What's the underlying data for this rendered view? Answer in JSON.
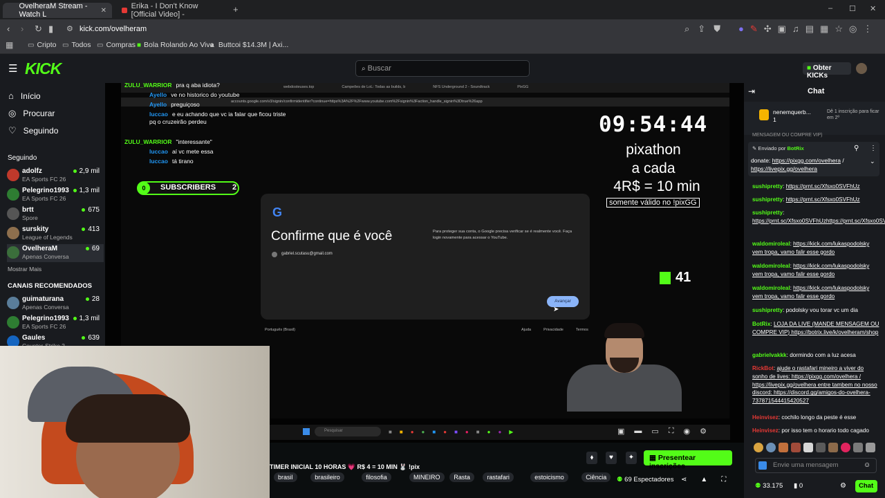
{
  "browser": {
    "tabs": [
      {
        "label": "OvelheraM Stream - Watch L",
        "active": true
      },
      {
        "label": "Erika - I Don't Know [Official Video] -",
        "active": false
      }
    ],
    "url": "kick.com/ovelheram",
    "bookmarks": [
      "Cripto",
      "Todos",
      "Compras",
      "Bola Rolando Ao Vivo",
      "Buttcoi $14.3M | Axi..."
    ]
  },
  "header": {
    "logo": "KICK",
    "search_placeholder": "Buscar",
    "obter": "Obter KICKs"
  },
  "nav": [
    {
      "icon": "home-icon",
      "label": "Início"
    },
    {
      "icon": "compass-icon",
      "label": "Procurar"
    },
    {
      "icon": "heart-icon",
      "label": "Seguindo"
    }
  ],
  "following_title": "Seguindo",
  "following": [
    {
      "name": "adolfz",
      "game": "EA Sports FC 26",
      "viewers": "2,9 mil",
      "color": "#c0392b"
    },
    {
      "name": "Pelegrino1993",
      "game": "EA Sports FC 26",
      "viewers": "1,3 mil",
      "color": "#2e7d32"
    },
    {
      "name": "brtt",
      "game": "Spore",
      "viewers": "675",
      "color": "#555"
    },
    {
      "name": "surskity",
      "game": "League of Legends",
      "viewers": "413",
      "color": "#8e6f4d"
    },
    {
      "name": "OvelheraM",
      "game": "Apenas Conversa",
      "viewers": "69",
      "color": "#3b6e3b"
    }
  ],
  "mostrar_mais": "Mostrar Mais",
  "recommended_title": "CANAIS RECOMENDADOS",
  "recommended": [
    {
      "name": "guimaturana",
      "game": "Apenas Conversa",
      "viewers": "28",
      "color": "#5a7d9a"
    },
    {
      "name": "Pelegrino1993",
      "game": "EA Sports FC 26",
      "viewers": "1,3 mil",
      "color": "#2e7d32"
    },
    {
      "name": "Gaules",
      "game": "Counter-Strike 2",
      "viewers": "639",
      "color": "#1565c0"
    }
  ],
  "stream": {
    "overlay_chat": [
      {
        "user": "ZULU_WARRIOR",
        "text": "pra q aba idiota?"
      },
      {
        "user": "Ayello",
        "text": "ve no historico do youtube"
      },
      {
        "user": "Ayello",
        "text": "preguiçoso"
      },
      {
        "user": "luccao",
        "text": "e eu achando que vc ia falar que ficou triste pq o cruzeirão perdeu"
      },
      {
        "user": "ZULU_WARRIOR",
        "text": "\"interessante\""
      },
      {
        "user": "luccao",
        "text": "aí vc mete essa"
      },
      {
        "user": "luccao",
        "text": "tá tirano"
      }
    ],
    "inner_tabs": [
      "webdosteuses.top",
      "Campeões de LoL: Todas as builds, b",
      "NFS Underground 2 - Soundtrack",
      "PixGG"
    ],
    "inner_url": "accounts.google.com/v3/signin/confirmidentifier?continue=https%3A%2F%2Fwww.youtube.com%2Fsignin%3Faction_handle_signin%3Dtrue%26app",
    "subscribers": {
      "left": "0",
      "label": "SUBSCRIBERS",
      "right": "2"
    },
    "google": {
      "title": "Confirme que é você",
      "email": "gabriel.scutasu@gmail.com",
      "desc": "Para proteger sua conta, o Google precisa verificar se é realmente você. Faça login novamente para acessar o YouTube.",
      "button": "Avançar",
      "lang": "Português (Brasil)",
      "links": [
        "Ajuda",
        "Privacidade",
        "Termos"
      ]
    },
    "timer": "09:54:44",
    "pixathon": [
      "pixathon",
      "a cada",
      "4R$ = 10 min"
    ],
    "valido": "somente válido no !pixGG",
    "kicks": "41",
    "taskbar_search": "Pesquisar"
  },
  "info": {
    "title": "TIMER INICIAL 10 HORAS 💗 R$ 4 = 10 MIN 🐰 !pix",
    "tags": [
      "brasil",
      "brasileiro",
      "filosofia",
      "MINEIRO",
      "Rasta",
      "rastafari",
      "estoicismo",
      "Ciência"
    ],
    "presentear": "Presentear inscrições",
    "viewers": "69 Espectadores"
  },
  "chat": {
    "title": "Chat",
    "top_user": "nenemquerb...",
    "top_count": "1",
    "top_note": "Dê 1 inscrição para ficar em 2º",
    "pinned_partial": "MENSAGEM OU COMPRE VIP)",
    "pinned_by": "Enviado por",
    "pinned_user": "BotRix",
    "pinned_text": "donate:",
    "pinned_link1": "https://pixgg.com/ovelhera",
    "pinned_link2": "https://livepix.gg/ovelhera",
    "messages": [
      {
        "user": "sushipretty",
        "text": "https://prnt.sc/Xfsxo0SVFhUz"
      },
      {
        "user": "sushipretty",
        "text": "https://prnt.sc/Xfsxo0SVFhUz"
      },
      {
        "user": "sushipretty",
        "text": "https://prnt.sc/Xfsxo0SVFhUzhttps://prnt.sc/Xfsxo0SVFhUz"
      },
      {
        "user": "waldomiroleal",
        "text": "https://kick.com/lukaspodolsky vem tropa, vamo falir esse gordo"
      },
      {
        "user": "waldomiroleal",
        "text": "https://kick.com/lukaspodolsky vem tropa, vamo falir esse gordo"
      },
      {
        "user": "waldomiroleal",
        "text": "https://kick.com/lukaspodolsky vem tropa, vamo falir esse gordo"
      },
      {
        "user": "sushipretty",
        "text": "podolsky vou torar vc um dia"
      },
      {
        "user": "BotRix",
        "text": "LOJA DA LIVE (MANDE MENSAGEM OU COMPRE VIP) https://botrix.live/k/ovelheram/shop"
      },
      {
        "user": "gabrielvakkk",
        "text": "dormindo com a luz acesa"
      },
      {
        "user": "RickBot",
        "text": "ajude o rastafari mineiro a viver do sonho de lives: https://pixgg.com/ovelhera / https://livepix.gg/ovelhera entre tambem no nosso discord: https://discord.gg/amigos-do-ovelhera-737871544415420527"
      },
      {
        "user": "Heinvisez",
        "text": "cochilo longo da peste é esse"
      },
      {
        "user": "Heinvisez",
        "text": "por isso tem o horario todo cagado"
      }
    ],
    "input_placeholder": "Envie uma mensagem",
    "points": "33.175",
    "zero": "0",
    "chat_button": "Chat"
  },
  "colors": {
    "accent": "#53fc18",
    "bg": "#0b0e0f",
    "panel": "#191b1f"
  }
}
